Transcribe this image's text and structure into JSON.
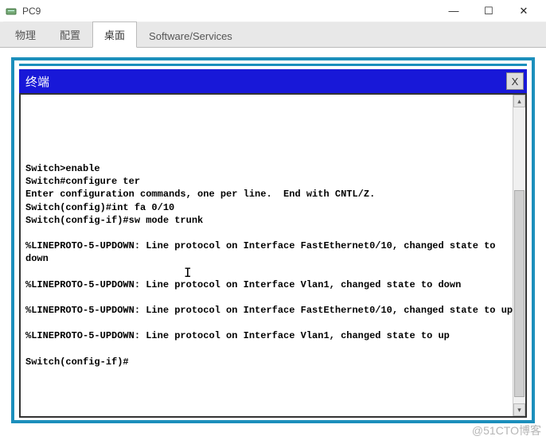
{
  "window": {
    "title": "PC9",
    "controls": {
      "minimize": "—",
      "maximize": "☐",
      "close": "✕"
    }
  },
  "tabs": {
    "items": [
      {
        "label": "物理",
        "active": false
      },
      {
        "label": "配置",
        "active": false
      },
      {
        "label": "桌面",
        "active": true
      },
      {
        "label": "Software/Services",
        "active": false
      }
    ]
  },
  "terminal": {
    "title": "终端",
    "close": "X",
    "lines": [
      "",
      "",
      "",
      "",
      "",
      "Switch>enable",
      "Switch#configure ter",
      "Enter configuration commands, one per line.  End with CNTL/Z.",
      "Switch(config)#int fa 0/10",
      "Switch(config-if)#sw mode trunk",
      "",
      "%LINEPROTO-5-UPDOWN: Line protocol on Interface FastEthernet0/10, changed state to down",
      "",
      "%LINEPROTO-5-UPDOWN: Line protocol on Interface Vlan1, changed state to down",
      "",
      "%LINEPROTO-5-UPDOWN: Line protocol on Interface FastEthernet0/10, changed state to up",
      "",
      "%LINEPROTO-5-UPDOWN: Line protocol on Interface Vlan1, changed state to up",
      "",
      "Switch(config-if)#"
    ]
  },
  "watermark": "@51CTO博客"
}
